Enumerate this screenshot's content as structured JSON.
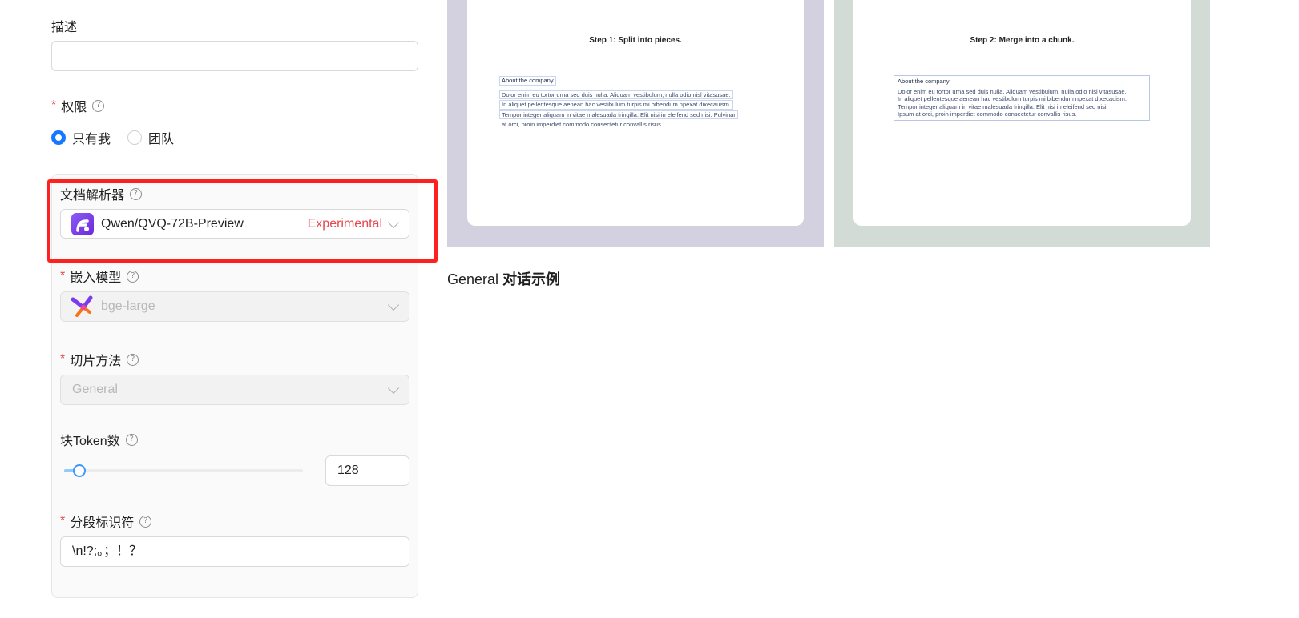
{
  "form": {
    "description": {
      "label": "描述",
      "value": ""
    },
    "permission": {
      "label": "权限",
      "options": [
        {
          "label": "只有我",
          "selected": true
        },
        {
          "label": "团队",
          "selected": false
        }
      ]
    },
    "parser": {
      "label": "文档解析器",
      "value": "Qwen/QVQ-72B-Preview",
      "badge": "Experimental",
      "icon": "qwen-app-icon"
    },
    "embedding": {
      "label": "嵌入模型",
      "value": "bge-large",
      "icon": "bge-model-icon"
    },
    "chunk_method": {
      "label": "切片方法",
      "value": "General"
    },
    "chunk_tokens": {
      "label": "块Token数",
      "value": "128",
      "slider_fraction": 0.06
    },
    "delimiter": {
      "label": "分段标识符",
      "value": "\\n!?;。；！？"
    }
  },
  "preview": {
    "left": {
      "title": "Step 1: Split into pieces.",
      "heading": "About the company",
      "lines": [
        "Dolor enim eu tortor urna sed duis nulla. Aliquam vestibulum, nulla odio nisl vitasusae.",
        "In aliquet pellentesque aenean hac vestibulum turpis mi bibendum npexat dixecauism.",
        "Tempor integer aliquam in vitae malesuada fringilla. Elit nisi in eleifend sed nisi. Pulvinar",
        "at orci, proin imperdiet commodo consectetur convallis risus."
      ]
    },
    "right": {
      "title": "Step 2: Merge into a chunk.",
      "heading": "About the company",
      "lines": [
        "Dolor enim eu tortor urna sed duis nulla. Aliquam vestibulum, nulla odio nisl vitasusae.",
        "In aliquet pellentesque aenean hac vestibulum turpis mi bibendum npexat dixecauism.",
        "Tempor integer aliquam in vitae malesuada fringilla. Elit nisi in eleifend sed nisi.",
        "Ipsum at orci, proin imperdiet commodo consectetur convallis risus."
      ]
    }
  },
  "section": {
    "title_prefix": "General",
    "title_suffix": "对话示例"
  },
  "colors": {
    "accent": "#1677ff",
    "required": "#e5484d",
    "experimental": "#e5484d",
    "highlight": "#ff2020"
  }
}
